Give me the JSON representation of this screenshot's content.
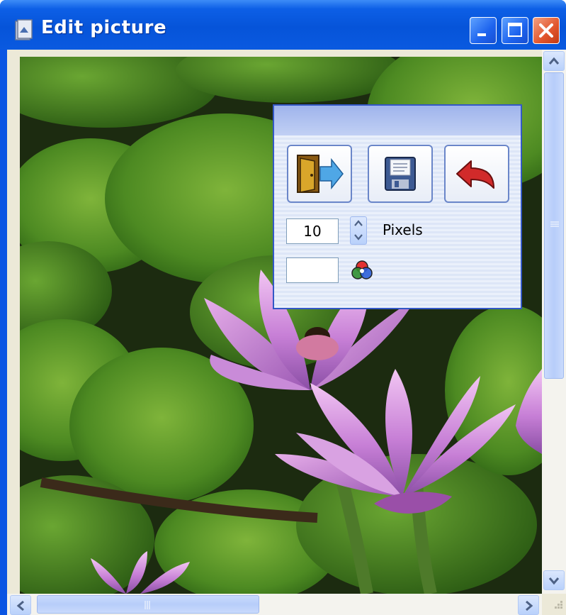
{
  "window": {
    "title": "Edit picture"
  },
  "caption_buttons": [
    "minimize",
    "maximize",
    "close"
  ],
  "tool_panel": {
    "buttons": [
      {
        "name": "exit",
        "icon": "door-exit-icon"
      },
      {
        "name": "save",
        "icon": "floppy-disk-icon"
      },
      {
        "name": "undo",
        "icon": "undo-arrow-icon"
      }
    ],
    "size_value": "10",
    "size_unit": "Pixels",
    "color_value": "",
    "color_icon": "rgb-color-circles-icon"
  },
  "colors": {
    "titlebar": "#0654d9",
    "close_button": "#e1542b",
    "panel_border": "#3358c6"
  }
}
